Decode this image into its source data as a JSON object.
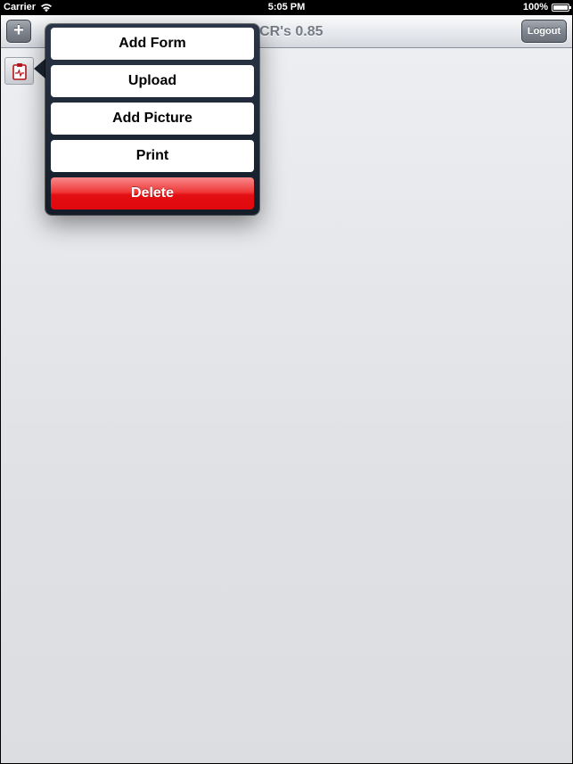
{
  "status_bar": {
    "carrier": "Carrier",
    "time": "5:05 PM",
    "battery": "100%"
  },
  "nav_bar": {
    "title": "PCR's 0.85",
    "add_label": "+",
    "logout_label": "Logout"
  },
  "popover": {
    "items": [
      {
        "label": "Add Form"
      },
      {
        "label": "Upload"
      },
      {
        "label": "Add Picture"
      },
      {
        "label": "Print"
      },
      {
        "label": "Delete"
      }
    ]
  },
  "colors": {
    "delete": "#e8171a",
    "popover": "#1b2533",
    "clipboard_icon": "#b3161c"
  },
  "icons": {
    "toolbar": "clipboard-icon"
  }
}
